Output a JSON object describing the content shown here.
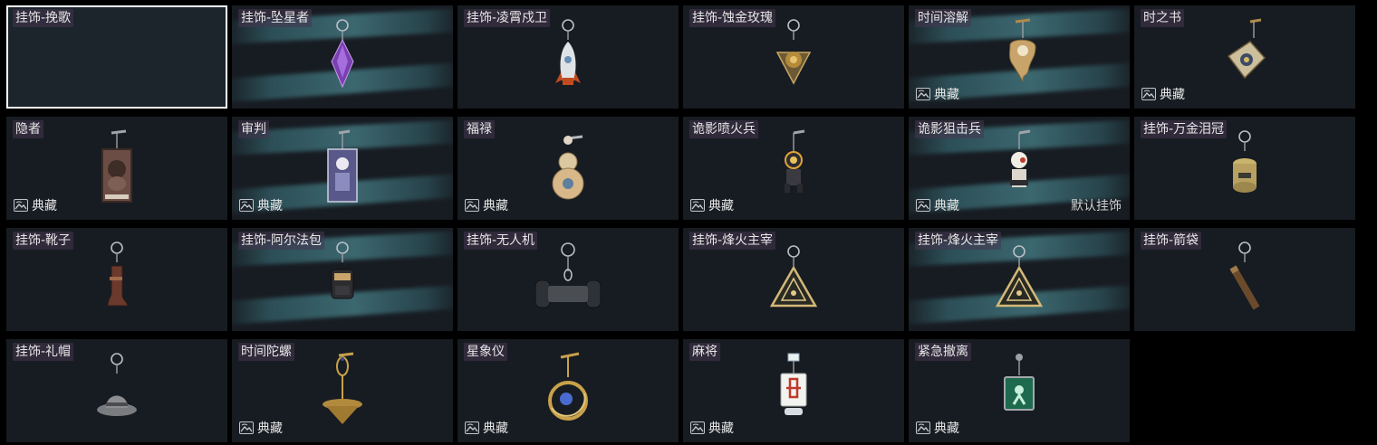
{
  "grid": {
    "cards": [
      {
        "name": "挂饰-挽歌",
        "badge": "",
        "default": "",
        "selected": true,
        "beam": false,
        "charm": "none-icon"
      },
      {
        "name": "挂饰-坠星者",
        "badge": "",
        "default": "",
        "selected": false,
        "beam": true,
        "charm": "crystal-charm-icon"
      },
      {
        "name": "挂饰-凌霄戍卫",
        "badge": "",
        "default": "",
        "selected": false,
        "beam": false,
        "charm": "rocket-charm-icon"
      },
      {
        "name": "挂饰-蚀金玫瑰",
        "badge": "",
        "default": "",
        "selected": false,
        "beam": false,
        "charm": "rose-emblem-charm-icon"
      },
      {
        "name": "时间溶解",
        "badge": "典藏",
        "default": "",
        "selected": false,
        "beam": true,
        "charm": "melting-clock-charm-icon"
      },
      {
        "name": "时之书",
        "badge": "典藏",
        "default": "",
        "selected": false,
        "beam": false,
        "charm": "book-charm-icon"
      },
      {
        "name": "隐者",
        "badge": "典藏",
        "default": "",
        "selected": false,
        "beam": false,
        "charm": "hermit-card-charm-icon"
      },
      {
        "name": "审判",
        "badge": "典藏",
        "default": "",
        "selected": false,
        "beam": true,
        "charm": "judgement-card-charm-icon"
      },
      {
        "name": "福禄",
        "badge": "典藏",
        "default": "",
        "selected": false,
        "beam": false,
        "charm": "gourd-charm-icon"
      },
      {
        "name": "诡影喷火兵",
        "badge": "典藏",
        "default": "",
        "selected": false,
        "beam": false,
        "charm": "flamethrower-figure-charm-icon"
      },
      {
        "name": "诡影狙击兵",
        "badge": "典藏",
        "default": "默认挂饰",
        "selected": false,
        "beam": true,
        "charm": "sniper-figure-charm-icon"
      },
      {
        "name": "挂饰-万金泪冠",
        "badge": "",
        "default": "",
        "selected": false,
        "beam": false,
        "charm": "gold-crown-charm-icon"
      },
      {
        "name": "挂饰-靴子",
        "badge": "",
        "default": "",
        "selected": false,
        "beam": false,
        "charm": "boot-charm-icon"
      },
      {
        "name": "挂饰-阿尔法包",
        "badge": "",
        "default": "",
        "selected": false,
        "beam": true,
        "charm": "backpack-charm-icon"
      },
      {
        "name": "挂饰-无人机",
        "badge": "",
        "default": "",
        "selected": false,
        "beam": false,
        "charm": "drone-charm-icon"
      },
      {
        "name": "挂饰-烽火主宰",
        "badge": "",
        "default": "",
        "selected": false,
        "beam": false,
        "charm": "triangle-emblem-charm-icon"
      },
      {
        "name": "挂饰-烽火主宰",
        "badge": "",
        "default": "",
        "selected": false,
        "beam": true,
        "charm": "triangle-emblem-charm-icon"
      },
      {
        "name": "挂饰-箭袋",
        "badge": "",
        "default": "",
        "selected": false,
        "beam": false,
        "charm": "quiver-charm-icon"
      },
      {
        "name": "挂饰-礼帽",
        "badge": "",
        "default": "",
        "selected": false,
        "beam": false,
        "charm": "hat-charm-icon"
      },
      {
        "name": "时间陀螺",
        "badge": "典藏",
        "default": "",
        "selected": false,
        "beam": false,
        "charm": "spinning-top-charm-icon"
      },
      {
        "name": "星象仪",
        "badge": "典藏",
        "default": "",
        "selected": false,
        "beam": false,
        "charm": "astrolabe-charm-icon"
      },
      {
        "name": "麻将",
        "badge": "典藏",
        "default": "",
        "selected": false,
        "beam": false,
        "charm": "mahjong-tile-charm-icon"
      },
      {
        "name": "紧急撤离",
        "badge": "典藏",
        "default": "",
        "selected": false,
        "beam": false,
        "charm": "exit-sign-charm-icon"
      }
    ]
  },
  "colors": {
    "background": "#000000",
    "card": "#171c22",
    "selected_border": "#ffffff",
    "label_bg": "#463750",
    "text": "#e6e6e6",
    "beam": "#5aa5af"
  }
}
